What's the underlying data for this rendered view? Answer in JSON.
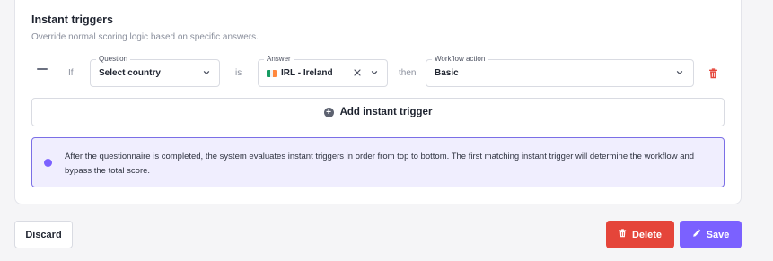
{
  "section": {
    "title": "Instant triggers",
    "subtitle": "Override normal scoring logic based on specific answers."
  },
  "trigger_row": {
    "if_word": "If",
    "is_word": "is",
    "then_word": "then",
    "question": {
      "label": "Question",
      "value": "Select country"
    },
    "answer": {
      "label": "Answer",
      "value": "IRL - Ireland",
      "flag_colors": [
        "#169b62",
        "#ffffff",
        "#ff883e"
      ]
    },
    "workflow": {
      "label": "Workflow action",
      "value": "Basic"
    }
  },
  "add_trigger_label": "Add instant trigger",
  "info": {
    "text": "After the questionnaire is completed, the system evaluates instant triggers in order from top to bottom. The first matching instant trigger will determine the workflow and bypass the total score."
  },
  "actions": {
    "discard_label": "Discard",
    "delete_label": "Delete",
    "save_label": "Save"
  },
  "colors": {
    "danger": "#e5453a",
    "primary": "#7b61ff"
  }
}
